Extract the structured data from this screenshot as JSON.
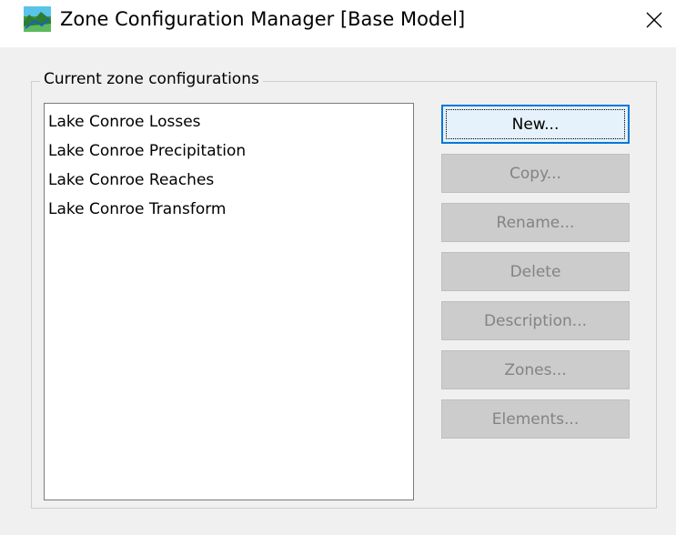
{
  "window": {
    "title": "Zone Configuration Manager [Base Model]",
    "close_glyph": "✕",
    "icon": "landscape-app-icon"
  },
  "group": {
    "label": "Current zone configurations"
  },
  "configurations": [
    {
      "label": "Lake Conroe Losses"
    },
    {
      "label": "Lake Conroe Precipitation"
    },
    {
      "label": "Lake Conroe Reaches"
    },
    {
      "label": "Lake Conroe Transform"
    }
  ],
  "buttons": {
    "new": {
      "label": "New...",
      "enabled": true,
      "default": true
    },
    "copy": {
      "label": "Copy...",
      "enabled": false
    },
    "rename": {
      "label": "Rename...",
      "enabled": false
    },
    "delete": {
      "label": "Delete",
      "enabled": false
    },
    "description": {
      "label": "Description...",
      "enabled": false
    },
    "zones": {
      "label": "Zones...",
      "enabled": false
    },
    "elements": {
      "label": "Elements...",
      "enabled": false
    }
  },
  "colors": {
    "default_button_border": "#0078d7",
    "disabled_text": "#838383",
    "window_background": "#f0f0f0"
  }
}
